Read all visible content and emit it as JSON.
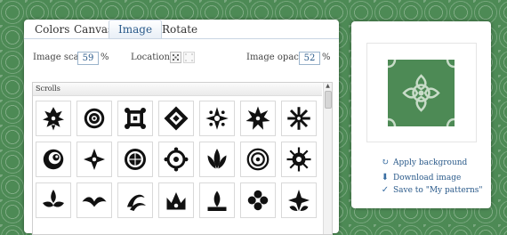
{
  "tabs": [
    {
      "label": "Colors",
      "active": false
    },
    {
      "label": "Canvas",
      "active": false
    },
    {
      "label": "Image",
      "active": true
    },
    {
      "label": "Rotate",
      "active": false
    }
  ],
  "controls": {
    "scale_label": "Image scale",
    "scale_value": "59",
    "scale_unit": "%",
    "location_label": "Location",
    "opacity_label": "Image opacity",
    "opacity_value": "52",
    "opacity_unit": "%"
  },
  "list": {
    "category": "Scrolls",
    "items": [
      "ornament-icon",
      "ornament-icon",
      "ornament-icon",
      "ornament-icon",
      "ornament-icon",
      "ornament-icon",
      "ornament-icon",
      "ornament-icon",
      "ornament-icon",
      "ornament-icon",
      "ornament-icon",
      "ornament-icon",
      "ornament-icon",
      "ornament-icon",
      "ornament-icon",
      "ornament-icon",
      "ornament-icon",
      "ornament-icon",
      "ornament-icon",
      "ornament-icon",
      "ornament-icon"
    ]
  },
  "actions": {
    "apply": "Apply background",
    "download": "Download image",
    "save": "Save to \"My patterns\""
  },
  "colors": {
    "background": "#4d8a55",
    "link": "#2a5a8a"
  }
}
